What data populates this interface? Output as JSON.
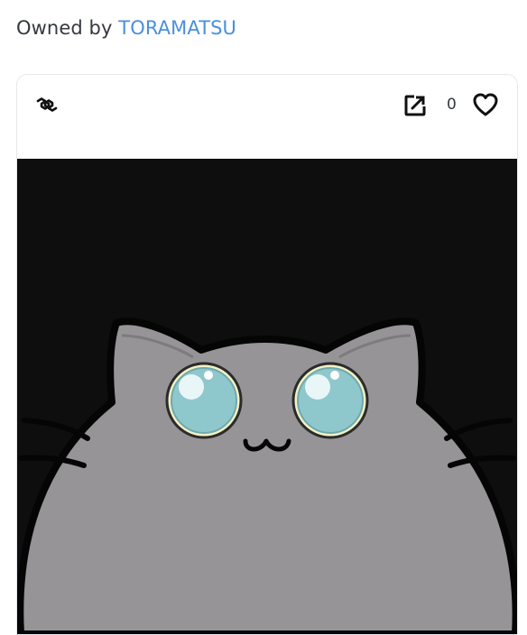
{
  "owner": {
    "prefix": "Owned by",
    "name": "TORAMATSU",
    "link_color": "#4a8fde"
  },
  "card": {
    "chain_icon": "polygon-chain-icon",
    "external_link_icon": "external-link-icon",
    "favorite_count": "0",
    "favorite_icon": "heart-outline-icon"
  },
  "artwork": {
    "background": "#0e0e0e",
    "cat_body_color": "#969496",
    "eye_color": "#8fc8cc",
    "eye_ring_color": "#f3f1c4"
  }
}
